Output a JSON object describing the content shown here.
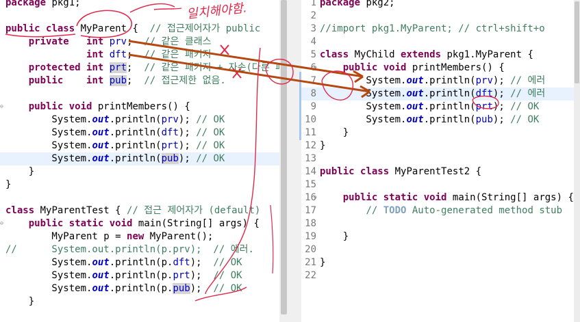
{
  "left_editor": {
    "lines": [
      {
        "segments": [
          {
            "t": "package",
            "c": "kw"
          },
          {
            "t": " pkg1;"
          }
        ]
      },
      {
        "segments": []
      },
      {
        "segments": [
          {
            "t": "public",
            "c": "kw"
          },
          {
            "t": " "
          },
          {
            "t": "class",
            "c": "kw"
          },
          {
            "t": " MyParent {  "
          },
          {
            "t": "// 접근제어자가 public",
            "c": "cm"
          }
        ]
      },
      {
        "segments": [
          {
            "t": "    "
          },
          {
            "t": "private",
            "c": "kw"
          },
          {
            "t": "   "
          },
          {
            "t": "int",
            "c": "kw"
          },
          {
            "t": " "
          },
          {
            "t": "prv",
            "c": "fld"
          },
          {
            "t": ";  "
          },
          {
            "t": "// 같은 클래스",
            "c": "cm"
          }
        ]
      },
      {
        "segments": [
          {
            "t": "              "
          },
          {
            "t": "int",
            "c": "kw"
          },
          {
            "t": " "
          },
          {
            "t": "dft",
            "c": "fld"
          },
          {
            "t": ";  "
          },
          {
            "t": "// 같은 패키지",
            "c": "cm"
          }
        ]
      },
      {
        "segments": [
          {
            "t": "    "
          },
          {
            "t": "protected",
            "c": "kw"
          },
          {
            "t": " "
          },
          {
            "t": "int",
            "c": "kw"
          },
          {
            "t": " "
          },
          {
            "t": "prt",
            "c": "fld occ"
          },
          {
            "t": ";  "
          },
          {
            "t": "// 같은 패키지 + 자손(다른 패)",
            "c": "cm"
          }
        ]
      },
      {
        "segments": [
          {
            "t": "    "
          },
          {
            "t": "public",
            "c": "kw"
          },
          {
            "t": "    "
          },
          {
            "t": "int",
            "c": "kw"
          },
          {
            "t": " "
          },
          {
            "t": "pub",
            "c": "fld occ"
          },
          {
            "t": ";  "
          },
          {
            "t": "// 접근제한 없음.",
            "c": "cm"
          }
        ]
      },
      {
        "segments": []
      },
      {
        "segments": [
          {
            "t": "    "
          },
          {
            "t": "public",
            "c": "kw"
          },
          {
            "t": " "
          },
          {
            "t": "void",
            "c": "kw"
          },
          {
            "t": " printMembers() {"
          }
        ],
        "fold": true
      },
      {
        "segments": [
          {
            "t": "        System."
          },
          {
            "t": "out",
            "c": "st"
          },
          {
            "t": ".println("
          },
          {
            "t": "prv",
            "c": "fld"
          },
          {
            "t": "); "
          },
          {
            "t": "// OK",
            "c": "cm"
          }
        ]
      },
      {
        "segments": [
          {
            "t": "        System."
          },
          {
            "t": "out",
            "c": "st"
          },
          {
            "t": ".println("
          },
          {
            "t": "dft",
            "c": "fld"
          },
          {
            "t": "); "
          },
          {
            "t": "// OK",
            "c": "cm"
          }
        ]
      },
      {
        "segments": [
          {
            "t": "        System."
          },
          {
            "t": "out",
            "c": "st"
          },
          {
            "t": ".println("
          },
          {
            "t": "prt",
            "c": "fld"
          },
          {
            "t": "); "
          },
          {
            "t": "// OK",
            "c": "cm"
          }
        ]
      },
      {
        "segments": [
          {
            "t": "        System."
          },
          {
            "t": "out",
            "c": "st"
          },
          {
            "t": ".println("
          },
          {
            "t": "pub",
            "c": "fld occ"
          },
          {
            "t": "); "
          },
          {
            "t": "// OK",
            "c": "cm"
          }
        ],
        "highlight": true
      },
      {
        "segments": [
          {
            "t": "    }"
          }
        ]
      },
      {
        "segments": [
          {
            "t": "}"
          }
        ]
      },
      {
        "segments": []
      },
      {
        "segments": [
          {
            "t": "class",
            "c": "kw"
          },
          {
            "t": " MyParentTest { "
          },
          {
            "t": "// 접근 제어자가 (default)",
            "c": "cm"
          }
        ]
      },
      {
        "segments": [
          {
            "t": "    "
          },
          {
            "t": "public",
            "c": "kw"
          },
          {
            "t": " "
          },
          {
            "t": "static",
            "c": "kw"
          },
          {
            "t": " "
          },
          {
            "t": "void",
            "c": "kw"
          },
          {
            "t": " main(String[] args) {"
          }
        ],
        "fold": true
      },
      {
        "segments": [
          {
            "t": "        MyParent p = "
          },
          {
            "t": "new",
            "c": "kw"
          },
          {
            "t": " MyParent();"
          }
        ]
      },
      {
        "segments": [
          {
            "t": "//      System.out.println(p.prv);  // 에러.",
            "c": "cm"
          }
        ]
      },
      {
        "segments": [
          {
            "t": "        System."
          },
          {
            "t": "out",
            "c": "st"
          },
          {
            "t": ".println(p."
          },
          {
            "t": "dft",
            "c": "fld"
          },
          {
            "t": ");  "
          },
          {
            "t": "// OK",
            "c": "cm"
          }
        ]
      },
      {
        "segments": [
          {
            "t": "        System."
          },
          {
            "t": "out",
            "c": "st"
          },
          {
            "t": ".println(p."
          },
          {
            "t": "prt",
            "c": "fld"
          },
          {
            "t": ");  "
          },
          {
            "t": "// OK",
            "c": "cm"
          }
        ]
      },
      {
        "segments": [
          {
            "t": "        System."
          },
          {
            "t": "out",
            "c": "st"
          },
          {
            "t": ".println(p."
          },
          {
            "t": "pub",
            "c": "fld occ"
          },
          {
            "t": ");  "
          },
          {
            "t": "// OK",
            "c": "cm"
          }
        ]
      },
      {
        "segments": [
          {
            "t": "    }"
          }
        ]
      },
      {
        "segments": []
      },
      {
        "segments": [
          {
            "t": "}"
          }
        ]
      }
    ]
  },
  "right_editor": {
    "lines": [
      {
        "n": "1",
        "segments": [
          {
            "t": "package",
            "c": "kw"
          },
          {
            "t": " pkg2;"
          }
        ]
      },
      {
        "n": "2",
        "segments": []
      },
      {
        "n": "3",
        "segments": [
          {
            "t": "//import pkg1.MyParent; // ctrl+shift+o",
            "c": "cm"
          }
        ]
      },
      {
        "n": "4",
        "segments": []
      },
      {
        "n": "5",
        "segments": [
          {
            "t": "class",
            "c": "kw"
          },
          {
            "t": " MyChild "
          },
          {
            "t": "extends",
            "c": "kw"
          },
          {
            "t": " pkg1.MyParent {"
          }
        ]
      },
      {
        "n": "6",
        "segments": [
          {
            "t": "    "
          },
          {
            "t": "public",
            "c": "kw"
          },
          {
            "t": " "
          },
          {
            "t": "void",
            "c": "kw"
          },
          {
            "t": " printMembers() {"
          }
        ],
        "fold": true
      },
      {
        "n": "7",
        "segments": [
          {
            "t": "        System."
          },
          {
            "t": "out",
            "c": "st"
          },
          {
            "t": ".println("
          },
          {
            "t": "prv",
            "c": "fld"
          },
          {
            "t": "); "
          },
          {
            "t": "// 에러",
            "c": "cm"
          }
        ]
      },
      {
        "n": "8",
        "segments": [
          {
            "t": "        System."
          },
          {
            "t": "out",
            "c": "st"
          },
          {
            "t": ".println("
          },
          {
            "t": "dft",
            "c": "fld"
          },
          {
            "t": "); "
          },
          {
            "t": "// 에러",
            "c": "cm"
          }
        ],
        "highlight": true
      },
      {
        "n": "9",
        "segments": [
          {
            "t": "        System."
          },
          {
            "t": "out",
            "c": "st"
          },
          {
            "t": ".println("
          },
          {
            "t": "prt",
            "c": "fld"
          },
          {
            "t": "); "
          },
          {
            "t": "// OK",
            "c": "cm"
          }
        ]
      },
      {
        "n": "10",
        "segments": [
          {
            "t": "        System."
          },
          {
            "t": "out",
            "c": "st"
          },
          {
            "t": ".println("
          },
          {
            "t": "pub",
            "c": "fld"
          },
          {
            "t": "); "
          },
          {
            "t": "// OK",
            "c": "cm"
          }
        ]
      },
      {
        "n": "11",
        "segments": [
          {
            "t": "    }"
          }
        ]
      },
      {
        "n": "12",
        "segments": [
          {
            "t": "}"
          }
        ]
      },
      {
        "n": "13",
        "segments": []
      },
      {
        "n": "14",
        "segments": [
          {
            "t": "public",
            "c": "kw"
          },
          {
            "t": " "
          },
          {
            "t": "class",
            "c": "kw"
          },
          {
            "t": " MyParentTest2 {"
          }
        ]
      },
      {
        "n": "15",
        "segments": []
      },
      {
        "n": "16",
        "segments": [
          {
            "t": "    "
          },
          {
            "t": "public",
            "c": "kw"
          },
          {
            "t": " "
          },
          {
            "t": "static",
            "c": "kw"
          },
          {
            "t": " "
          },
          {
            "t": "void",
            "c": "kw"
          },
          {
            "t": " main(String[] args) {"
          }
        ],
        "fold": true,
        "marker": "16⊖"
      },
      {
        "n": "17",
        "segments": [
          {
            "t": "        "
          },
          {
            "t": "// ",
            "c": "cm"
          },
          {
            "t": "TODO",
            "c": "todo"
          },
          {
            "t": " Auto-generated method stub",
            "c": "cm"
          }
        ],
        "marker": "17"
      },
      {
        "n": "18",
        "segments": []
      },
      {
        "n": "19",
        "segments": [
          {
            "t": "    }"
          }
        ]
      },
      {
        "n": "20",
        "segments": []
      },
      {
        "n": "21",
        "segments": [
          {
            "t": "}"
          }
        ]
      },
      {
        "n": "22",
        "segments": []
      }
    ]
  },
  "annotation": {
    "handwritten_note": "일치해야함.",
    "ink_color": "#e0294a",
    "arrow_color": "#b5470f"
  }
}
